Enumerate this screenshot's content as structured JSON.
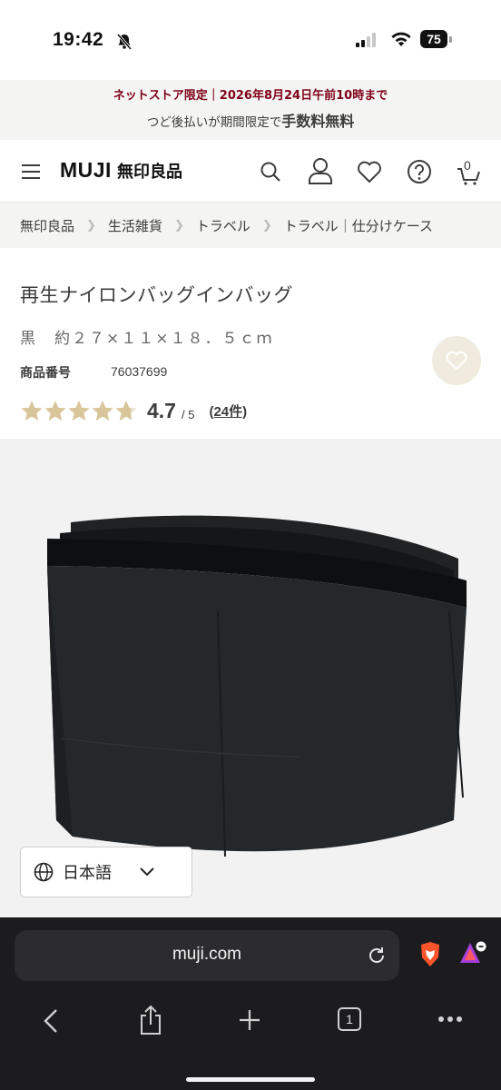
{
  "status": {
    "time": "19:42",
    "battery": "75"
  },
  "promo": {
    "line1": "ネットストア限定｜2026年8月24日午前10時まで",
    "line2_prefix": "つど後払いが期間限定で",
    "line2_bold": "手数料無料"
  },
  "header": {
    "brand": "MUJI",
    "brand_jp": "無印良品",
    "cart_count": "0"
  },
  "breadcrumb": [
    "無印良品",
    "生活雑貨",
    "トラベル",
    "トラベル｜仕分けケース"
  ],
  "product": {
    "title": "再生ナイロンバッグインバッグ",
    "variant": "黒　約２７×１１×１８．５ｃｍ",
    "number_label": "商品番号",
    "number": "76037699",
    "rating_score": "4.7",
    "rating_max": "/ 5",
    "review_count": "(24件)",
    "rating_value": 4.7
  },
  "language": {
    "label": "日本語"
  },
  "browser": {
    "url": "muji.com",
    "tab_count": "1"
  },
  "colors": {
    "accent_red": "#7f0019",
    "star": "#d9c59a",
    "fav_bg": "#f1ebdf"
  }
}
